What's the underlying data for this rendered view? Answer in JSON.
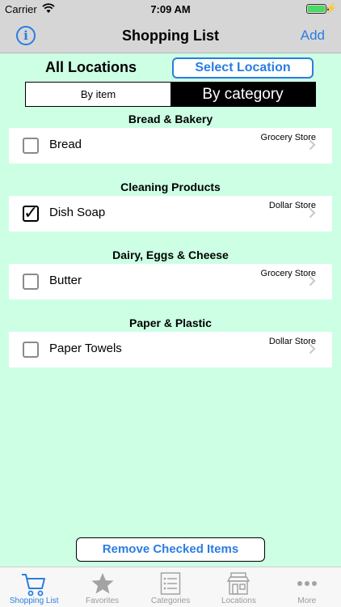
{
  "status_bar": {
    "carrier": "Carrier",
    "time": "7:09 AM"
  },
  "nav": {
    "title": "Shopping List",
    "add_label": "Add",
    "info_icon": "info-icon"
  },
  "location": {
    "label": "All Locations",
    "select_button": "Select Location"
  },
  "segmented": {
    "by_item": "By item",
    "by_category": "By category",
    "selected": "by_category"
  },
  "sections": [
    {
      "title": "Bread & Bakery",
      "items": [
        {
          "name": "Bread",
          "store": "Grocery Store",
          "checked": false
        }
      ]
    },
    {
      "title": "Cleaning Products",
      "items": [
        {
          "name": "Dish Soap",
          "store": "Dollar Store",
          "checked": true
        }
      ]
    },
    {
      "title": "Dairy, Eggs & Cheese",
      "items": [
        {
          "name": "Butter",
          "store": "Grocery Store",
          "checked": false
        }
      ]
    },
    {
      "title": "Paper & Plastic",
      "items": [
        {
          "name": "Paper Towels",
          "store": "Dollar Store",
          "checked": false
        }
      ]
    }
  ],
  "remove_button": "Remove Checked Items",
  "tabs": [
    {
      "label": "Shopping List",
      "icon": "cart-icon",
      "active": true
    },
    {
      "label": "Favorites",
      "icon": "star-icon",
      "active": false
    },
    {
      "label": "Categories",
      "icon": "list-icon",
      "active": false
    },
    {
      "label": "Locations",
      "icon": "store-icon",
      "active": false
    },
    {
      "label": "More",
      "icon": "more-icon",
      "active": false
    }
  ],
  "colors": {
    "background": "#ccffe4",
    "accent": "#2a7de1",
    "bars": "#d6d6d6"
  }
}
